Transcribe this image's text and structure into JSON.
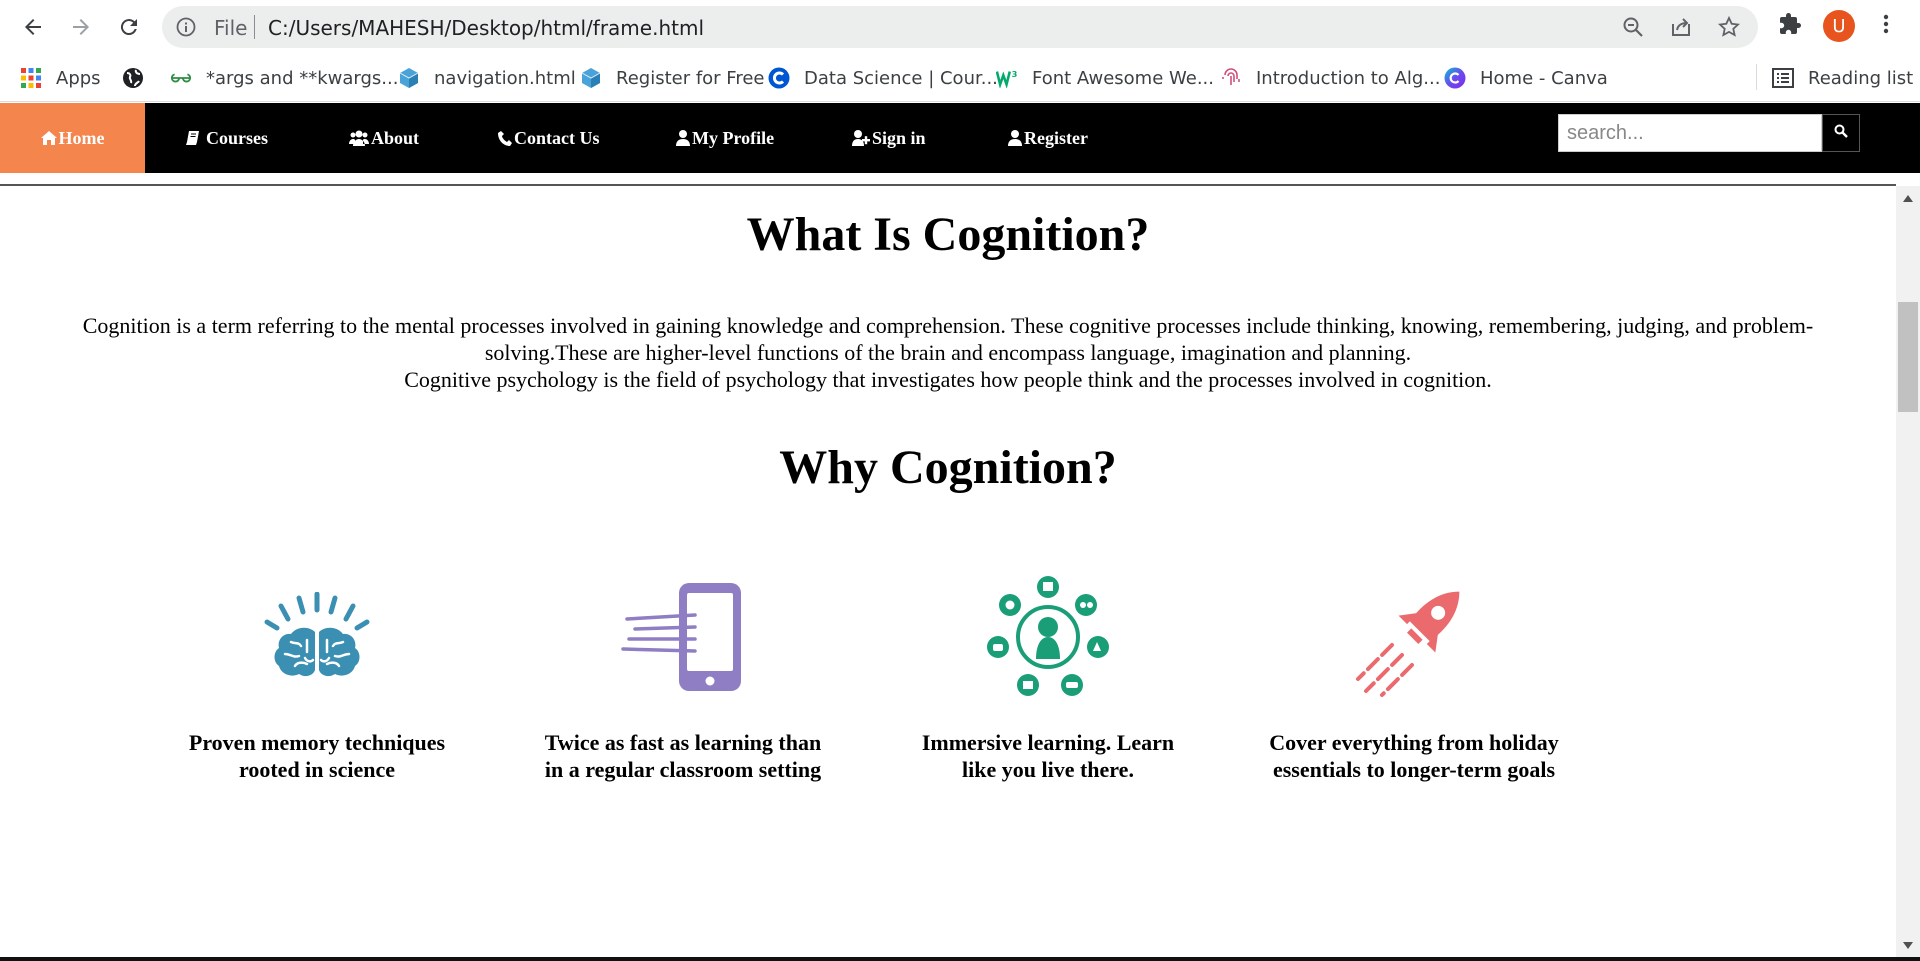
{
  "browser": {
    "omnibox": {
      "scheme_label": "File",
      "url": "C:/Users/MAHESH/Desktop/html/frame.html"
    },
    "profile_initial": "U",
    "bookmarks": [
      {
        "label": "Apps",
        "icon": "apps-grid-icon"
      },
      {
        "label": "",
        "icon": "globe-icon"
      },
      {
        "label": "*args and **kwargs...",
        "icon": "geeksforgeeks-icon"
      },
      {
        "label": "navigation.html",
        "icon": "file-cube-icon"
      },
      {
        "label": "Register for Free",
        "icon": "file-cube-icon"
      },
      {
        "label": "Data Science | Cour...",
        "icon": "coursera-icon"
      },
      {
        "label": "Font Awesome We...",
        "icon": "w3schools-icon"
      },
      {
        "label": "Introduction to Alg...",
        "icon": "fingerprint-icon"
      },
      {
        "label": "Home - Canva",
        "icon": "canva-icon"
      }
    ],
    "reading_list": "Reading list"
  },
  "nav": {
    "home": "Home",
    "courses": "Courses",
    "about": "About",
    "contact": "Contact Us",
    "profile": "My Profile",
    "signin": "Sign in",
    "register": "Register",
    "search_placeholder": "search...",
    "active_color": "#f4854d"
  },
  "main": {
    "title": "What Is Cognition?",
    "paragraph_lines": [
      "Cognition is a term referring to the mental processes involved in gaining knowledge and comprehension. These cognitive processes include thinking, knowing, remembering, judging, and problem-solving.These are higher-level functions of the brain and encompass language, imagination and planning.",
      "Cognitive psychology is the field of psychology that investigates how people think and the processes involved in cognition."
    ],
    "subtitle": "Why Cognition?",
    "features": [
      {
        "label": "Proven memory techniques rooted in science",
        "icon": "brain-icon",
        "color": "#3a8fb2"
      },
      {
        "label": "Twice as fast as learning than in a regular classroom setting",
        "icon": "phone-icon",
        "color": "#8f7ec4"
      },
      {
        "label": "Immersive learning. Learn like you live there.",
        "icon": "people-network-icon",
        "color": "#1a9e78"
      },
      {
        "label": "Cover everything from holiday essentials to longer-term goals",
        "icon": "rocket-icon",
        "color": "#ea6a6e"
      }
    ]
  }
}
